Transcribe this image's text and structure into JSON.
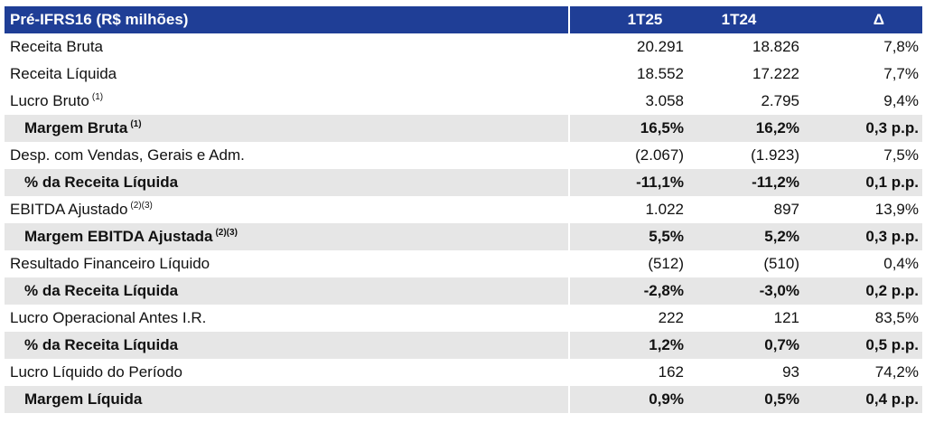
{
  "header": {
    "title": "Pré-IFRS16 (R$ milhões)",
    "col1": "1T25",
    "col2": "1T24",
    "col3": "Δ"
  },
  "rows": [
    {
      "label": "Receita Bruta",
      "sup": "",
      "v1": "20.291",
      "v2": "18.826",
      "v3": "7,8%",
      "sub": false
    },
    {
      "label": "Receita Líquida",
      "sup": "",
      "v1": "18.552",
      "v2": "17.222",
      "v3": "7,7%",
      "sub": false
    },
    {
      "label": "Lucro Bruto",
      "sup": "(1)",
      "v1": "3.058",
      "v2": "2.795",
      "v3": "9,4%",
      "sub": false
    },
    {
      "label": "Margem Bruta",
      "sup": "(1)",
      "v1": "16,5%",
      "v2": "16,2%",
      "v3": "0,3 p.p.",
      "sub": true
    },
    {
      "label": "Desp. com Vendas, Gerais e Adm.",
      "sup": "",
      "v1": "(2.067)",
      "v2": "(1.923)",
      "v3": "7,5%",
      "sub": false
    },
    {
      "label": "% da Receita Líquida",
      "sup": "",
      "v1": "-11,1%",
      "v2": "-11,2%",
      "v3": "0,1 p.p.",
      "sub": true
    },
    {
      "label": "EBITDA Ajustado",
      "sup": "(2)(3)",
      "v1": "1.022",
      "v2": "897",
      "v3": "13,9%",
      "sub": false
    },
    {
      "label": "Margem EBITDA Ajustada",
      "sup": "(2)(3)",
      "v1": "5,5%",
      "v2": "5,2%",
      "v3": "0,3 p.p.",
      "sub": true
    },
    {
      "label": "Resultado Financeiro Líquido",
      "sup": "",
      "v1": "(512)",
      "v2": "(510)",
      "v3": "0,4%",
      "sub": false
    },
    {
      "label": "% da Receita Líquida",
      "sup": "",
      "v1": "-2,8%",
      "v2": "-3,0%",
      "v3": "0,2 p.p.",
      "sub": true
    },
    {
      "label": "Lucro Operacional Antes I.R.",
      "sup": "",
      "v1": "222",
      "v2": "121",
      "v3": "83,5%",
      "sub": false
    },
    {
      "label": "% da Receita Líquida",
      "sup": "",
      "v1": "1,2%",
      "v2": "0,7%",
      "v3": "0,5 p.p.",
      "sub": true
    },
    {
      "label": "Lucro Líquido do Período",
      "sup": "",
      "v1": "162",
      "v2": "93",
      "v3": "74,2%",
      "sub": false
    },
    {
      "label": "Margem Líquida",
      "sup": "",
      "v1": "0,9%",
      "v2": "0,5%",
      "v3": "0,4 p.p.",
      "sub": true
    }
  ]
}
